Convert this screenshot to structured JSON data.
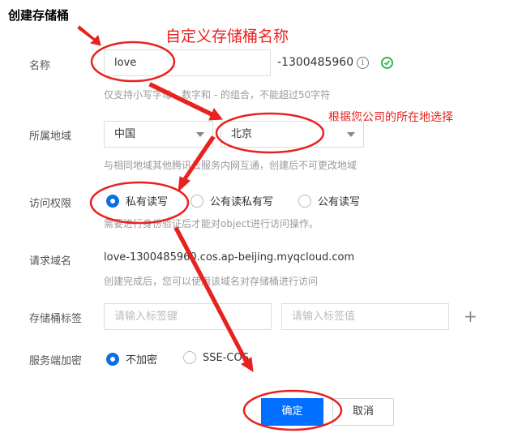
{
  "form": {
    "title": "创建存储桶",
    "name": {
      "label": "名称",
      "value": "love",
      "suffix": "-1300485960",
      "hint": "仅支持小写字母、数字和 - 的组合，不能超过50字符"
    },
    "region": {
      "label": "所属地域",
      "area": "中国",
      "city": "北京",
      "hint": "与相同地域其他腾讯云服务内网互通，创建后不可更改地域"
    },
    "access": {
      "label": "访问权限",
      "options": [
        "私有读写",
        "公有读私有写",
        "公有读写"
      ],
      "selected": 0,
      "hint": "需要进行身份验证后才能对object进行访问操作。"
    },
    "domain": {
      "label": "请求域名",
      "value": "love-1300485960.cos.ap-beijing.myqcloud.com",
      "hint": "创建完成后，您可以使用该域名对存储桶进行访问"
    },
    "tags": {
      "label": "存储桶标签",
      "key_placeholder": "请输入标签键",
      "value_placeholder": "请输入标签值",
      "add_symbol": "+"
    },
    "encryption": {
      "label": "服务端加密",
      "options": [
        "不加密",
        "SSE-COS"
      ],
      "selected": 0
    },
    "confirm_label": "确定",
    "cancel_label": "取消"
  },
  "annotations": {
    "custom_name": "自定义存储桶名称",
    "choose_region": "根据您公司的所在地选择"
  },
  "colors": {
    "accent": "#006eff",
    "success": "#2db84d",
    "annotation": "#e8221f"
  }
}
